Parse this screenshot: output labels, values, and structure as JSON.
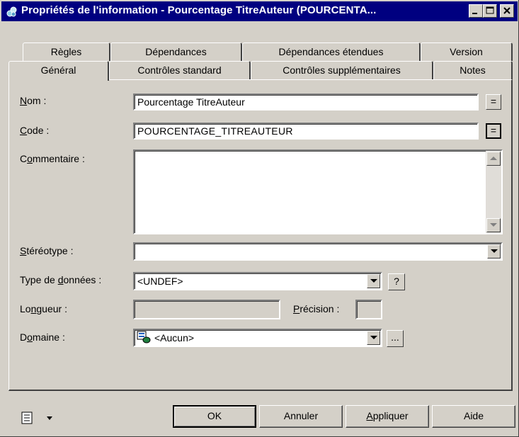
{
  "window": {
    "title": "Propriétés de l'information - Pourcentage TitreAuteur (POURCENTA...",
    "buttons": [
      "minimize",
      "maximize",
      "close"
    ]
  },
  "tabs_row1": [
    "Règles",
    "Dépendances",
    "Dépendances étendues",
    "Version"
  ],
  "tabs_row2": [
    "Général",
    "Contrôles standard",
    "Contrôles supplémentaires",
    "Notes"
  ],
  "active_tab": "Général",
  "form": {
    "nom": {
      "label_u": "N",
      "label_rest": "om :",
      "value": "Pourcentage TitreAuteur",
      "button": "="
    },
    "code": {
      "label_u": "C",
      "label_rest": "ode :",
      "value": "POURCENTAGE_TITREAUTEUR",
      "button": "="
    },
    "commentaire": {
      "label_pre": "C",
      "label_u": "o",
      "label_rest": "mmentaire :",
      "value": ""
    },
    "stereotype": {
      "label_u": "S",
      "label_rest": "téréotype :",
      "value": ""
    },
    "type": {
      "label_pre": "Type de ",
      "label_u": "d",
      "label_rest": "onnées :",
      "value": "<UNDEF>",
      "help": "?"
    },
    "longueur": {
      "label_pre": "Lo",
      "label_u": "n",
      "label_rest": "gueur :",
      "value": ""
    },
    "precision": {
      "label_u": "P",
      "label_rest": "récision :",
      "value": ""
    },
    "domaine": {
      "label_pre": "D",
      "label_u": "o",
      "label_rest": "maine :",
      "value": "<Aucun>",
      "browse": "..."
    }
  },
  "footer": {
    "menu_icon": "list-menu-icon",
    "ok": "OK",
    "cancel": "Annuler",
    "apply_u": "A",
    "apply_rest": "ppliquer",
    "help": "Aide"
  }
}
